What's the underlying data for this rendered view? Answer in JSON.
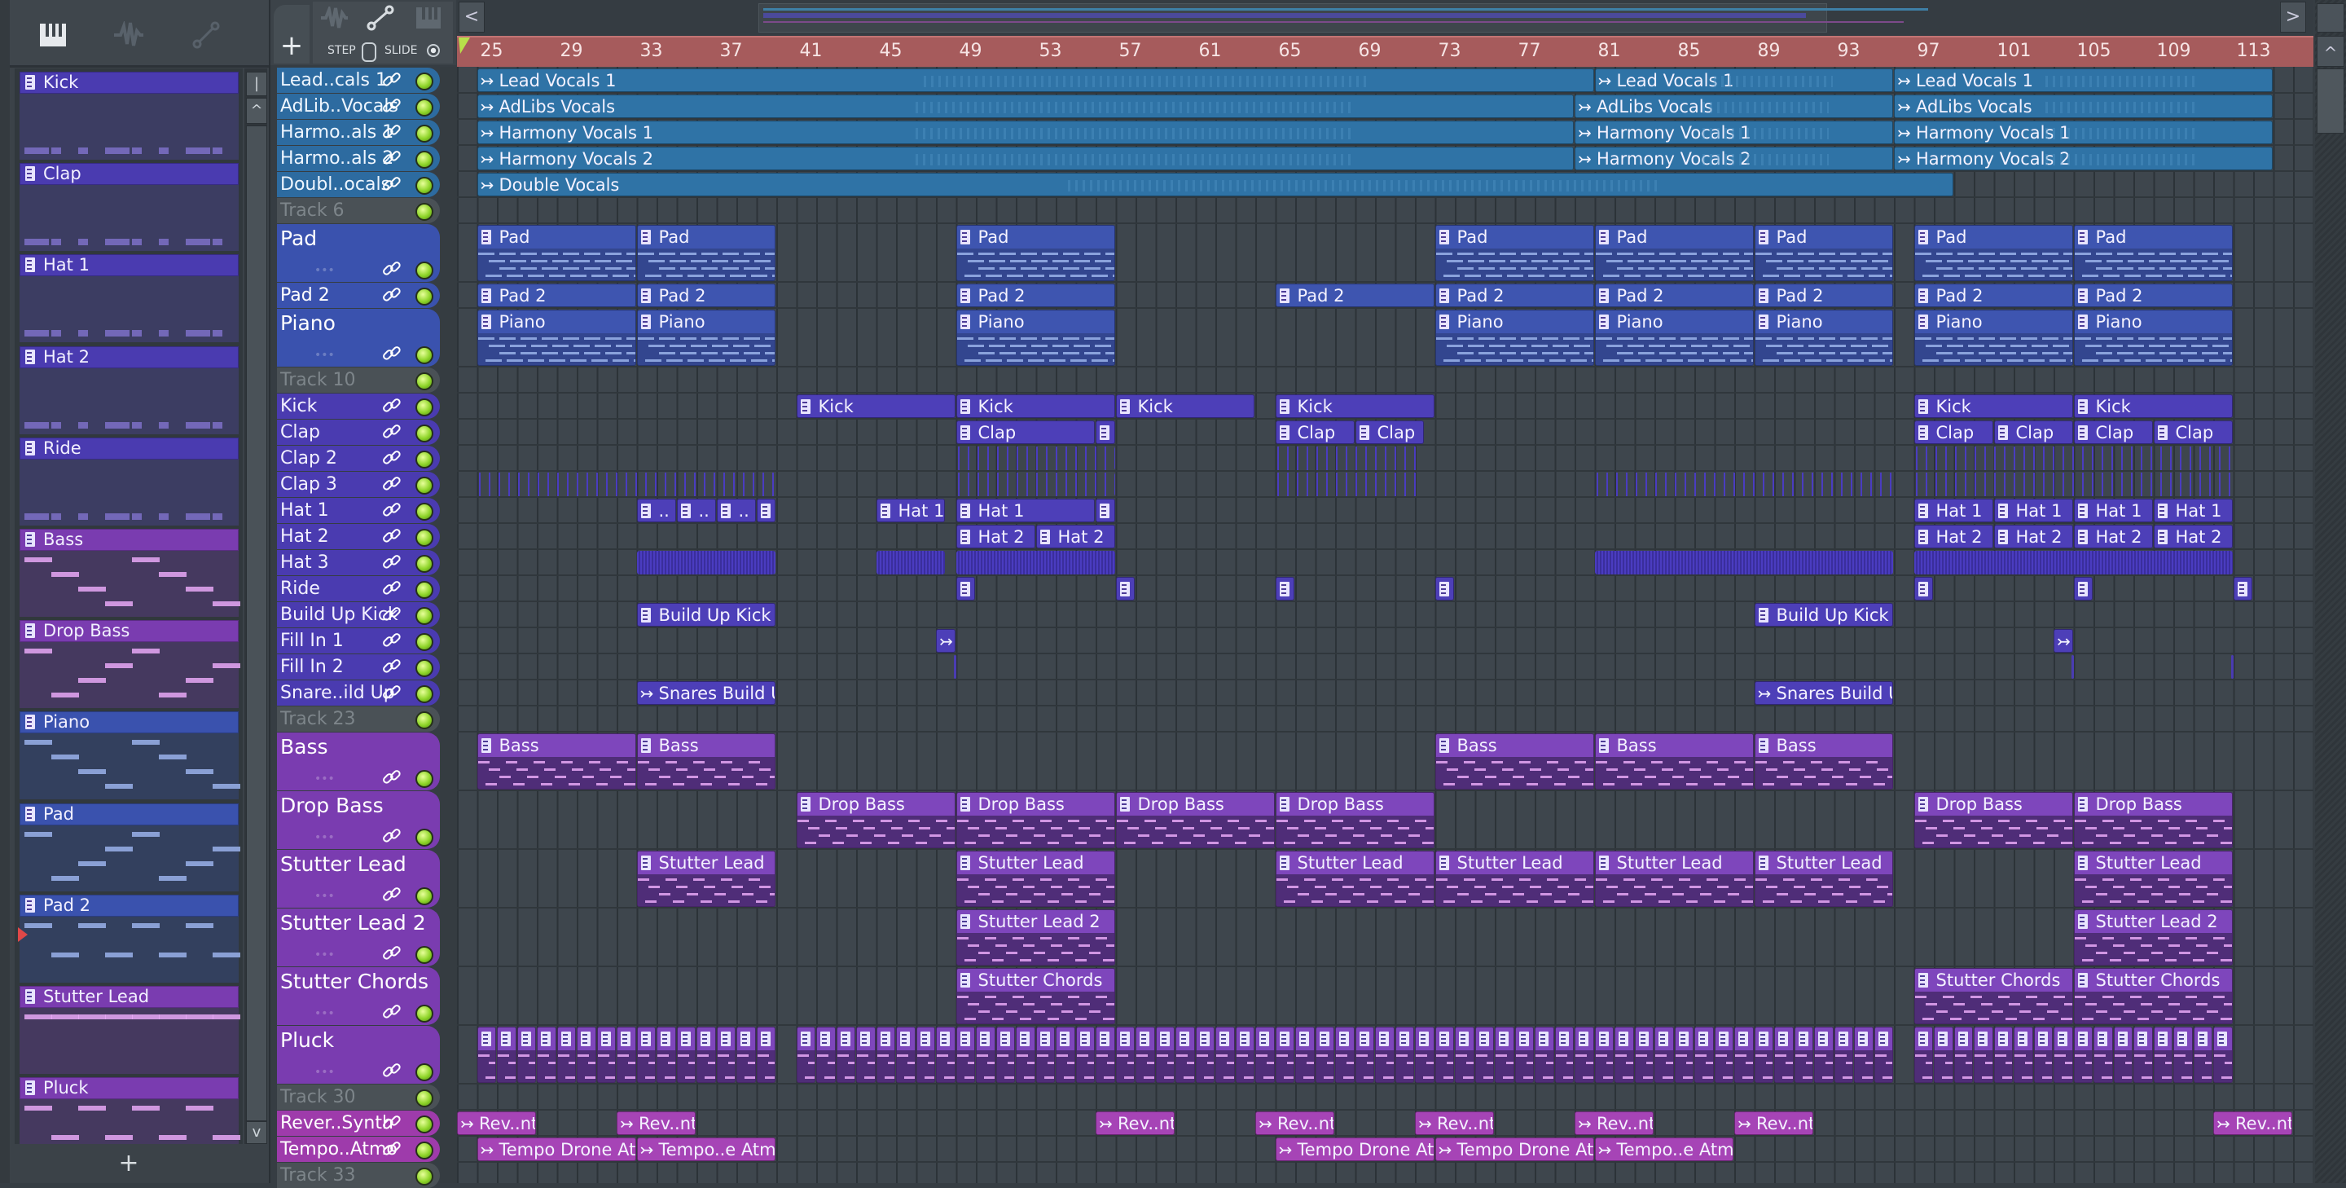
{
  "colors": {
    "vocal": "#2b6c9c",
    "pad": "#3a50aa",
    "drum": "#4a3bb0",
    "synth": "#7a3cb0",
    "fx": "#9e3bab",
    "empty": "#4a5156",
    "ruler": "#a65b5c",
    "led": "#8fd52a"
  },
  "toolbar": {
    "add_label": "+",
    "step_label": "STEP",
    "slide_label": "SLIDE",
    "icons": [
      "piano-roll-icon",
      "waveform-icon",
      "automation-icon"
    ],
    "scroll_left": "<",
    "scroll_right": ">"
  },
  "channel_rack": {
    "add_label": "+",
    "scroll_top": "|",
    "scroll_up": "^",
    "scroll_down": "v",
    "items": [
      {
        "label": "Kick",
        "type": "drum"
      },
      {
        "label": "Clap",
        "type": "drum"
      },
      {
        "label": "Hat 1",
        "type": "drum"
      },
      {
        "label": "Hat 2",
        "type": "drum"
      },
      {
        "label": "Ride",
        "type": "drum"
      },
      {
        "label": "Bass",
        "type": "synth"
      },
      {
        "label": "Drop Bass",
        "type": "synth"
      },
      {
        "label": "Piano",
        "type": "pad"
      },
      {
        "label": "Pad",
        "type": "pad"
      },
      {
        "label": "Pad 2",
        "type": "pad"
      },
      {
        "label": "Stutter Lead",
        "type": "synth"
      },
      {
        "label": "Pluck",
        "type": "synth"
      }
    ]
  },
  "ruler": {
    "bars": [
      "25",
      "29",
      "33",
      "37",
      "41",
      "45",
      "49",
      "53",
      "57",
      "61",
      "65",
      "69",
      "73",
      "77",
      "81",
      "85",
      "89",
      "93",
      "97",
      "101",
      "105",
      "109",
      "113"
    ]
  },
  "playlist": {
    "view_start_bar": 24,
    "tracks": [
      {
        "label": "Lead..cals 1",
        "type": "vocal",
        "clips": [
          {
            "s": 25,
            "e": 81,
            "label": "Lead Vocals 1",
            "kind": "audio"
          },
          {
            "s": 81,
            "e": 96,
            "label": "Lead Vocals 1",
            "kind": "audio"
          },
          {
            "s": 96,
            "e": 115,
            "label": "Lead Vocals 1",
            "kind": "audio"
          }
        ]
      },
      {
        "label": "AdLib..Vocals",
        "type": "vocal",
        "clips": [
          {
            "s": 25,
            "e": 80,
            "label": "AdLibs Vocals",
            "kind": "audio"
          },
          {
            "s": 80,
            "e": 96,
            "label": "AdLibs Vocals",
            "kind": "audio"
          },
          {
            "s": 96,
            "e": 115,
            "label": "AdLibs Vocals",
            "kind": "audio"
          }
        ]
      },
      {
        "label": "Harmo..als 1",
        "type": "vocal",
        "clips": [
          {
            "s": 25,
            "e": 80,
            "label": "Harmony Vocals 1",
            "kind": "audio"
          },
          {
            "s": 80,
            "e": 96,
            "label": "Harmony Vocals 1",
            "kind": "audio"
          },
          {
            "s": 96,
            "e": 115,
            "label": "Harmony Vocals 1",
            "kind": "audio"
          }
        ]
      },
      {
        "label": "Harmo..als 2",
        "type": "vocal",
        "clips": [
          {
            "s": 25,
            "e": 80,
            "label": "Harmony Vocals 2",
            "kind": "audio"
          },
          {
            "s": 80,
            "e": 96,
            "label": "Harmony Vocals 2",
            "kind": "audio"
          },
          {
            "s": 96,
            "e": 115,
            "label": "Harmony Vocals 2",
            "kind": "audio"
          }
        ]
      },
      {
        "label": "Doubl..ocals",
        "type": "vocal",
        "clips": [
          {
            "s": 25,
            "e": 99,
            "label": "Double Vocals",
            "kind": "audio"
          }
        ]
      },
      {
        "label": "Track 6",
        "type": "empty",
        "clips": []
      },
      {
        "label": "Pad",
        "type": "pad",
        "tall": true,
        "clips": [
          {
            "s": 25,
            "e": 33,
            "label": "Pad"
          },
          {
            "s": 33,
            "e": 40,
            "label": "Pad"
          },
          {
            "s": 49,
            "e": 57,
            "label": "Pad"
          },
          {
            "s": 73,
            "e": 81,
            "label": "Pad"
          },
          {
            "s": 81,
            "e": 89,
            "label": "Pad"
          },
          {
            "s": 89,
            "e": 96,
            "label": "Pad"
          },
          {
            "s": 97,
            "e": 105,
            "label": "Pad"
          },
          {
            "s": 105,
            "e": 113,
            "label": "Pad"
          }
        ]
      },
      {
        "label": "Pad 2",
        "type": "pad",
        "clips": [
          {
            "s": 25,
            "e": 33,
            "label": "Pad 2"
          },
          {
            "s": 33,
            "e": 40,
            "label": "Pad 2"
          },
          {
            "s": 49,
            "e": 57,
            "label": "Pad 2"
          },
          {
            "s": 65,
            "e": 73,
            "label": "Pad 2"
          },
          {
            "s": 73,
            "e": 81,
            "label": "Pad 2"
          },
          {
            "s": 81,
            "e": 89,
            "label": "Pad 2"
          },
          {
            "s": 89,
            "e": 96,
            "label": "Pad 2"
          },
          {
            "s": 97,
            "e": 105,
            "label": "Pad 2"
          },
          {
            "s": 105,
            "e": 113,
            "label": "Pad 2"
          }
        ]
      },
      {
        "label": "Piano",
        "type": "pad",
        "tall": true,
        "clips": [
          {
            "s": 25,
            "e": 33,
            "label": "Piano"
          },
          {
            "s": 33,
            "e": 40,
            "label": "Piano"
          },
          {
            "s": 49,
            "e": 57,
            "label": "Piano"
          },
          {
            "s": 73,
            "e": 81,
            "label": "Piano"
          },
          {
            "s": 81,
            "e": 89,
            "label": "Piano"
          },
          {
            "s": 89,
            "e": 96,
            "label": "Piano"
          },
          {
            "s": 97,
            "e": 105,
            "label": "Piano"
          },
          {
            "s": 105,
            "e": 113,
            "label": "Piano"
          }
        ]
      },
      {
        "label": "Track 10",
        "type": "empty",
        "clips": []
      },
      {
        "label": "Kick",
        "type": "drum",
        "clips": [
          {
            "s": 41,
            "e": 49,
            "label": "Kick"
          },
          {
            "s": 49,
            "e": 57,
            "label": "Kick"
          },
          {
            "s": 57,
            "e": 64,
            "label": "Kick"
          },
          {
            "s": 65,
            "e": 73,
            "label": "Kick"
          },
          {
            "s": 97,
            "e": 105,
            "label": "Kick"
          },
          {
            "s": 105,
            "e": 113,
            "label": "Kick"
          }
        ]
      },
      {
        "label": "Clap",
        "type": "drum",
        "clips": [
          {
            "s": 49,
            "e": 56,
            "label": "Clap"
          },
          {
            "s": 56,
            "e": 57,
            "label": ""
          },
          {
            "s": 65,
            "e": 69,
            "label": "Clap"
          },
          {
            "s": 69,
            "e": 72.5,
            "label": "Clap"
          },
          {
            "s": 97,
            "e": 101,
            "label": "Clap"
          },
          {
            "s": 101,
            "e": 105,
            "label": "Clap"
          },
          {
            "s": 105,
            "e": 109,
            "label": "Clap"
          },
          {
            "s": 109,
            "e": 113,
            "label": "Clap"
          }
        ]
      },
      {
        "label": "Clap 2",
        "type": "drum",
        "clips": [
          {
            "s": 49,
            "e": 57,
            "kind": "ticks"
          },
          {
            "s": 65,
            "e": 72.5,
            "kind": "ticks"
          },
          {
            "s": 97,
            "e": 113,
            "kind": "ticks"
          }
        ]
      },
      {
        "label": "Clap 3",
        "type": "drum",
        "clips": [
          {
            "s": 25,
            "e": 40,
            "kind": "ticks"
          },
          {
            "s": 49,
            "e": 57,
            "kind": "ticks"
          },
          {
            "s": 65,
            "e": 72.5,
            "kind": "ticks"
          },
          {
            "s": 81,
            "e": 96,
            "kind": "ticks"
          },
          {
            "s": 97,
            "e": 113,
            "kind": "ticks"
          }
        ]
      },
      {
        "label": "Hat 1",
        "type": "drum",
        "clips": [
          {
            "s": 33,
            "e": 35,
            "label": ".."
          },
          {
            "s": 35,
            "e": 37,
            "label": ".."
          },
          {
            "s": 37,
            "e": 39,
            "label": ".."
          },
          {
            "s": 39,
            "e": 40,
            "label": ""
          },
          {
            "s": 45,
            "e": 48.5,
            "label": "Hat 1"
          },
          {
            "s": 49,
            "e": 56,
            "label": "Hat 1"
          },
          {
            "s": 56,
            "e": 57,
            "label": ""
          },
          {
            "s": 97,
            "e": 101,
            "label": "Hat 1"
          },
          {
            "s": 101,
            "e": 105,
            "label": "Hat 1"
          },
          {
            "s": 105,
            "e": 109,
            "label": "Hat 1"
          },
          {
            "s": 109,
            "e": 113,
            "label": "Hat 1"
          }
        ]
      },
      {
        "label": "Hat 2",
        "type": "drum",
        "clips": [
          {
            "s": 49,
            "e": 53,
            "label": "Hat 2"
          },
          {
            "s": 53,
            "e": 57,
            "label": "Hat 2"
          },
          {
            "s": 97,
            "e": 101,
            "label": "Hat 2"
          },
          {
            "s": 101,
            "e": 105,
            "label": "Hat 2"
          },
          {
            "s": 105,
            "e": 109,
            "label": "Hat 2"
          },
          {
            "s": 109,
            "e": 113,
            "label": "Hat 2"
          }
        ]
      },
      {
        "label": "Hat 3",
        "type": "drum",
        "clips": [
          {
            "s": 33,
            "e": 40,
            "kind": "dense"
          },
          {
            "s": 45,
            "e": 48.5,
            "kind": "dense"
          },
          {
            "s": 49,
            "e": 57,
            "kind": "dense"
          },
          {
            "s": 81,
            "e": 96,
            "kind": "dense"
          },
          {
            "s": 97,
            "e": 113,
            "kind": "dense"
          }
        ]
      },
      {
        "label": "Ride",
        "type": "drum",
        "clips": [
          {
            "s": 49,
            "e": 50,
            "label": ""
          },
          {
            "s": 57,
            "e": 58,
            "label": ""
          },
          {
            "s": 65,
            "e": 66,
            "label": ""
          },
          {
            "s": 73,
            "e": 74,
            "label": ""
          },
          {
            "s": 97,
            "e": 98,
            "label": ""
          },
          {
            "s": 105,
            "e": 106,
            "label": ""
          },
          {
            "s": 113,
            "e": 114,
            "label": ""
          }
        ]
      },
      {
        "label": "Build Up Kick",
        "type": "drum",
        "clips": [
          {
            "s": 33,
            "e": 40,
            "label": "Build Up Kick"
          },
          {
            "s": 89,
            "e": 96,
            "label": "Build Up Kick"
          }
        ]
      },
      {
        "label": "Fill In 1",
        "type": "drum",
        "clips": [
          {
            "s": 48,
            "e": 49,
            "label": "",
            "kind": "audio"
          },
          {
            "s": 104,
            "e": 105,
            "label": "",
            "kind": "audio"
          }
        ]
      },
      {
        "label": "Fill In 2",
        "type": "drum",
        "clips": [
          {
            "s": 48.9,
            "e": 49.05,
            "kind": "thin"
          },
          {
            "s": 104.9,
            "e": 105.05,
            "kind": "thin"
          },
          {
            "s": 112.9,
            "e": 113.05,
            "kind": "thin"
          }
        ]
      },
      {
        "label": "Snare..ild Up",
        "type": "drum",
        "clips": [
          {
            "s": 33,
            "e": 40,
            "label": "Snares Build Up",
            "kind": "audio"
          },
          {
            "s": 89,
            "e": 96,
            "label": "Snares Build Up",
            "kind": "audio"
          }
        ]
      },
      {
        "label": "Track 23",
        "type": "empty",
        "clips": []
      },
      {
        "label": "Bass",
        "type": "synth",
        "tall": true,
        "clips": [
          {
            "s": 25,
            "e": 33,
            "label": "Bass"
          },
          {
            "s": 33,
            "e": 40,
            "label": "Bass"
          },
          {
            "s": 73,
            "e": 81,
            "label": "Bass"
          },
          {
            "s": 81,
            "e": 89,
            "label": "Bass"
          },
          {
            "s": 89,
            "e": 96,
            "label": "Bass"
          }
        ]
      },
      {
        "label": "Drop Bass",
        "type": "synth",
        "tall": true,
        "clips": [
          {
            "s": 41,
            "e": 49,
            "label": "Drop Bass"
          },
          {
            "s": 49,
            "e": 57,
            "label": "Drop Bass"
          },
          {
            "s": 57,
            "e": 65,
            "label": "Drop Bass"
          },
          {
            "s": 65,
            "e": 73,
            "label": "Drop Bass"
          },
          {
            "s": 97,
            "e": 105,
            "label": "Drop Bass"
          },
          {
            "s": 105,
            "e": 113,
            "label": "Drop Bass"
          }
        ]
      },
      {
        "label": "Stutter Lead",
        "type": "synth",
        "tall": true,
        "clips": [
          {
            "s": 33,
            "e": 40,
            "label": "Stutter Lead"
          },
          {
            "s": 49,
            "e": 57,
            "label": "Stutter Lead"
          },
          {
            "s": 65,
            "e": 73,
            "label": "Stutter Lead"
          },
          {
            "s": 73,
            "e": 81,
            "label": "Stutter Lead"
          },
          {
            "s": 81,
            "e": 89,
            "label": "Stutter Lead"
          },
          {
            "s": 89,
            "e": 96,
            "label": "Stutter Lead"
          },
          {
            "s": 105,
            "e": 113,
            "label": "Stutter Lead"
          }
        ]
      },
      {
        "label": "Stutter Lead 2",
        "type": "synth",
        "tall": true,
        "clips": [
          {
            "s": 49,
            "e": 57,
            "label": "Stutter Lead 2"
          },
          {
            "s": 105,
            "e": 113,
            "label": "Stutter Lead 2"
          }
        ]
      },
      {
        "label": "Stutter Chords",
        "type": "synth",
        "tall": true,
        "clips": [
          {
            "s": 49,
            "e": 57,
            "label": "Stutter Chords"
          },
          {
            "s": 97,
            "e": 105,
            "label": "Stutter Chords"
          },
          {
            "s": 105,
            "e": 113,
            "label": "Stutter Chords"
          }
        ]
      },
      {
        "label": "Pluck",
        "type": "synth",
        "tall": true,
        "repeat": [
          [
            25,
            40
          ],
          [
            41,
            96
          ],
          [
            97,
            113
          ]
        ],
        "clips": []
      },
      {
        "label": "Track 30",
        "type": "empty",
        "clips": []
      },
      {
        "label": "Rever..Synth",
        "type": "fx",
        "clips": [
          {
            "s": 24,
            "e": 28,
            "label": "Rev..nth",
            "kind": "audio"
          },
          {
            "s": 32,
            "e": 36,
            "label": "Rev..nth",
            "kind": "audio"
          },
          {
            "s": 56,
            "e": 60,
            "label": "Rev..nth",
            "kind": "audio"
          },
          {
            "s": 64,
            "e": 68,
            "label": "Rev..nth",
            "kind": "audio"
          },
          {
            "s": 72,
            "e": 76,
            "label": "Rev..nth",
            "kind": "audio"
          },
          {
            "s": 80,
            "e": 84,
            "label": "Rev..nth",
            "kind": "audio"
          },
          {
            "s": 88,
            "e": 92,
            "label": "Rev..nth",
            "kind": "audio"
          },
          {
            "s": 112,
            "e": 116,
            "label": "Rev..nth",
            "kind": "audio"
          }
        ]
      },
      {
        "label": "Tempo..Atmo",
        "type": "fx",
        "clips": [
          {
            "s": 25,
            "e": 33,
            "label": "Tempo Drone Atmo",
            "kind": "audio"
          },
          {
            "s": 33,
            "e": 40,
            "label": "Tempo..e Atmo",
            "kind": "audio"
          },
          {
            "s": 65,
            "e": 73,
            "label": "Tempo Drone Atmo",
            "kind": "audio"
          },
          {
            "s": 73,
            "e": 81,
            "label": "Tempo Drone Atmo",
            "kind": "audio"
          },
          {
            "s": 81,
            "e": 88,
            "label": "Tempo..e Atmo",
            "kind": "audio"
          }
        ]
      },
      {
        "label": "Track 33",
        "type": "empty",
        "clips": []
      }
    ]
  }
}
